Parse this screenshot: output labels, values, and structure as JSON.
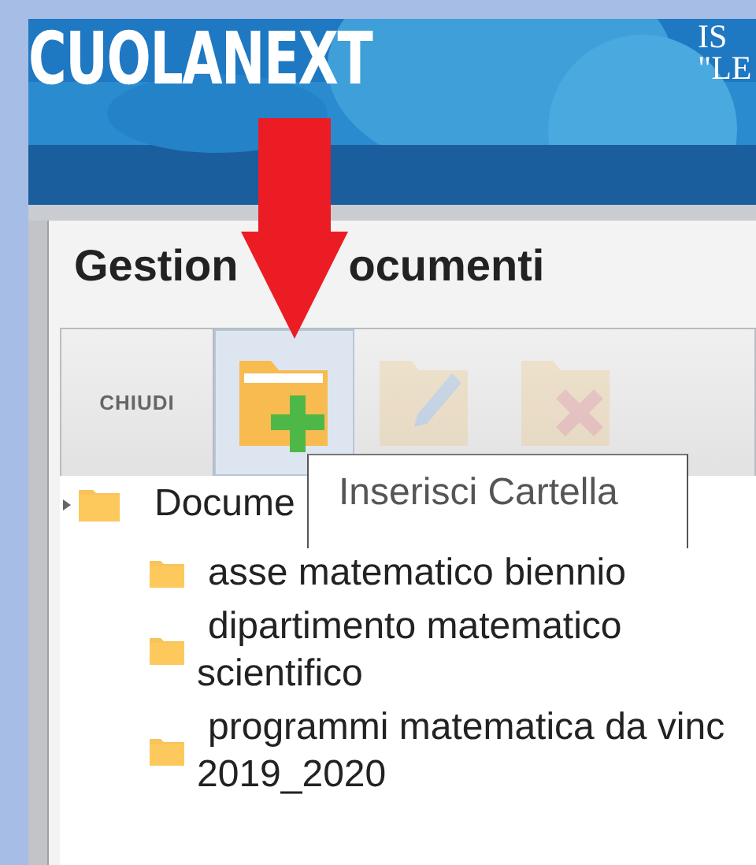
{
  "header": {
    "logo": "CUOLANEXT",
    "school_lines": [
      "IS",
      "\"LE"
    ]
  },
  "window": {
    "title_parts": [
      "Gestion",
      "ocumenti"
    ]
  },
  "toolbar": [
    {
      "kind": "text",
      "label": "CHIUDI",
      "hovered": false,
      "disabled": false
    },
    {
      "kind": "add-folder",
      "hovered": true,
      "disabled": false
    },
    {
      "kind": "edit",
      "hovered": false,
      "disabled": true
    },
    {
      "kind": "delete",
      "hovered": false,
      "disabled": true
    }
  ],
  "tooltip": "Inserisci Cartella",
  "tree": {
    "label": "Docume",
    "children": [
      {
        "lines": [
          "asse matematico biennio"
        ]
      },
      {
        "lines": [
          "dipartimento matematico",
          "scientifico"
        ]
      },
      {
        "lines": [
          "programmi matematica da vinc",
          "2019_2020"
        ]
      }
    ]
  }
}
